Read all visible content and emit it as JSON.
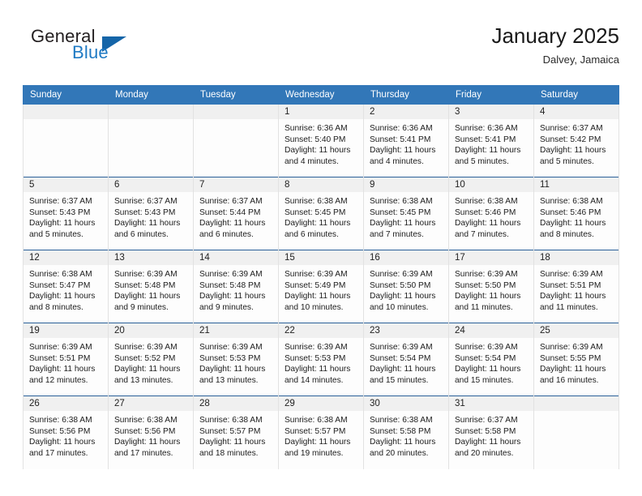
{
  "brand": {
    "word_general": "General",
    "word_blue": "Blue",
    "accent_color": "#1f7ac4",
    "triangle_color": "#1565a8"
  },
  "header": {
    "title": "January 2025",
    "subtitle": "Dalvey, Jamaica"
  },
  "theme": {
    "header_row_bg": "#3277b8",
    "daynum_strip_bg": "#f0f0f0",
    "cell_top_border": "#2a6099"
  },
  "weekday_headers": [
    "Sunday",
    "Monday",
    "Tuesday",
    "Wednesday",
    "Thursday",
    "Friday",
    "Saturday"
  ],
  "labels": {
    "sunrise_prefix": "Sunrise:",
    "sunset_prefix": "Sunset:",
    "daylight_prefix": "Daylight:"
  },
  "weeks": [
    [
      {
        "day": "",
        "sunrise": "",
        "sunset": "",
        "daylight": ""
      },
      {
        "day": "",
        "sunrise": "",
        "sunset": "",
        "daylight": ""
      },
      {
        "day": "",
        "sunrise": "",
        "sunset": "",
        "daylight": ""
      },
      {
        "day": "1",
        "sunrise": "Sunrise: 6:36 AM",
        "sunset": "Sunset: 5:40 PM",
        "daylight": "Daylight: 11 hours and 4 minutes."
      },
      {
        "day": "2",
        "sunrise": "Sunrise: 6:36 AM",
        "sunset": "Sunset: 5:41 PM",
        "daylight": "Daylight: 11 hours and 4 minutes."
      },
      {
        "day": "3",
        "sunrise": "Sunrise: 6:36 AM",
        "sunset": "Sunset: 5:41 PM",
        "daylight": "Daylight: 11 hours and 5 minutes."
      },
      {
        "day": "4",
        "sunrise": "Sunrise: 6:37 AM",
        "sunset": "Sunset: 5:42 PM",
        "daylight": "Daylight: 11 hours and 5 minutes."
      }
    ],
    [
      {
        "day": "5",
        "sunrise": "Sunrise: 6:37 AM",
        "sunset": "Sunset: 5:43 PM",
        "daylight": "Daylight: 11 hours and 5 minutes."
      },
      {
        "day": "6",
        "sunrise": "Sunrise: 6:37 AM",
        "sunset": "Sunset: 5:43 PM",
        "daylight": "Daylight: 11 hours and 6 minutes."
      },
      {
        "day": "7",
        "sunrise": "Sunrise: 6:37 AM",
        "sunset": "Sunset: 5:44 PM",
        "daylight": "Daylight: 11 hours and 6 minutes."
      },
      {
        "day": "8",
        "sunrise": "Sunrise: 6:38 AM",
        "sunset": "Sunset: 5:45 PM",
        "daylight": "Daylight: 11 hours and 6 minutes."
      },
      {
        "day": "9",
        "sunrise": "Sunrise: 6:38 AM",
        "sunset": "Sunset: 5:45 PM",
        "daylight": "Daylight: 11 hours and 7 minutes."
      },
      {
        "day": "10",
        "sunrise": "Sunrise: 6:38 AM",
        "sunset": "Sunset: 5:46 PM",
        "daylight": "Daylight: 11 hours and 7 minutes."
      },
      {
        "day": "11",
        "sunrise": "Sunrise: 6:38 AM",
        "sunset": "Sunset: 5:46 PM",
        "daylight": "Daylight: 11 hours and 8 minutes."
      }
    ],
    [
      {
        "day": "12",
        "sunrise": "Sunrise: 6:38 AM",
        "sunset": "Sunset: 5:47 PM",
        "daylight": "Daylight: 11 hours and 8 minutes."
      },
      {
        "day": "13",
        "sunrise": "Sunrise: 6:39 AM",
        "sunset": "Sunset: 5:48 PM",
        "daylight": "Daylight: 11 hours and 9 minutes."
      },
      {
        "day": "14",
        "sunrise": "Sunrise: 6:39 AM",
        "sunset": "Sunset: 5:48 PM",
        "daylight": "Daylight: 11 hours and 9 minutes."
      },
      {
        "day": "15",
        "sunrise": "Sunrise: 6:39 AM",
        "sunset": "Sunset: 5:49 PM",
        "daylight": "Daylight: 11 hours and 10 minutes."
      },
      {
        "day": "16",
        "sunrise": "Sunrise: 6:39 AM",
        "sunset": "Sunset: 5:50 PM",
        "daylight": "Daylight: 11 hours and 10 minutes."
      },
      {
        "day": "17",
        "sunrise": "Sunrise: 6:39 AM",
        "sunset": "Sunset: 5:50 PM",
        "daylight": "Daylight: 11 hours and 11 minutes."
      },
      {
        "day": "18",
        "sunrise": "Sunrise: 6:39 AM",
        "sunset": "Sunset: 5:51 PM",
        "daylight": "Daylight: 11 hours and 11 minutes."
      }
    ],
    [
      {
        "day": "19",
        "sunrise": "Sunrise: 6:39 AM",
        "sunset": "Sunset: 5:51 PM",
        "daylight": "Daylight: 11 hours and 12 minutes."
      },
      {
        "day": "20",
        "sunrise": "Sunrise: 6:39 AM",
        "sunset": "Sunset: 5:52 PM",
        "daylight": "Daylight: 11 hours and 13 minutes."
      },
      {
        "day": "21",
        "sunrise": "Sunrise: 6:39 AM",
        "sunset": "Sunset: 5:53 PM",
        "daylight": "Daylight: 11 hours and 13 minutes."
      },
      {
        "day": "22",
        "sunrise": "Sunrise: 6:39 AM",
        "sunset": "Sunset: 5:53 PM",
        "daylight": "Daylight: 11 hours and 14 minutes."
      },
      {
        "day": "23",
        "sunrise": "Sunrise: 6:39 AM",
        "sunset": "Sunset: 5:54 PM",
        "daylight": "Daylight: 11 hours and 15 minutes."
      },
      {
        "day": "24",
        "sunrise": "Sunrise: 6:39 AM",
        "sunset": "Sunset: 5:54 PM",
        "daylight": "Daylight: 11 hours and 15 minutes."
      },
      {
        "day": "25",
        "sunrise": "Sunrise: 6:39 AM",
        "sunset": "Sunset: 5:55 PM",
        "daylight": "Daylight: 11 hours and 16 minutes."
      }
    ],
    [
      {
        "day": "26",
        "sunrise": "Sunrise: 6:38 AM",
        "sunset": "Sunset: 5:56 PM",
        "daylight": "Daylight: 11 hours and 17 minutes."
      },
      {
        "day": "27",
        "sunrise": "Sunrise: 6:38 AM",
        "sunset": "Sunset: 5:56 PM",
        "daylight": "Daylight: 11 hours and 17 minutes."
      },
      {
        "day": "28",
        "sunrise": "Sunrise: 6:38 AM",
        "sunset": "Sunset: 5:57 PM",
        "daylight": "Daylight: 11 hours and 18 minutes."
      },
      {
        "day": "29",
        "sunrise": "Sunrise: 6:38 AM",
        "sunset": "Sunset: 5:57 PM",
        "daylight": "Daylight: 11 hours and 19 minutes."
      },
      {
        "day": "30",
        "sunrise": "Sunrise: 6:38 AM",
        "sunset": "Sunset: 5:58 PM",
        "daylight": "Daylight: 11 hours and 20 minutes."
      },
      {
        "day": "31",
        "sunrise": "Sunrise: 6:37 AM",
        "sunset": "Sunset: 5:58 PM",
        "daylight": "Daylight: 11 hours and 20 minutes."
      },
      {
        "day": "",
        "sunrise": "",
        "sunset": "",
        "daylight": ""
      }
    ]
  ]
}
